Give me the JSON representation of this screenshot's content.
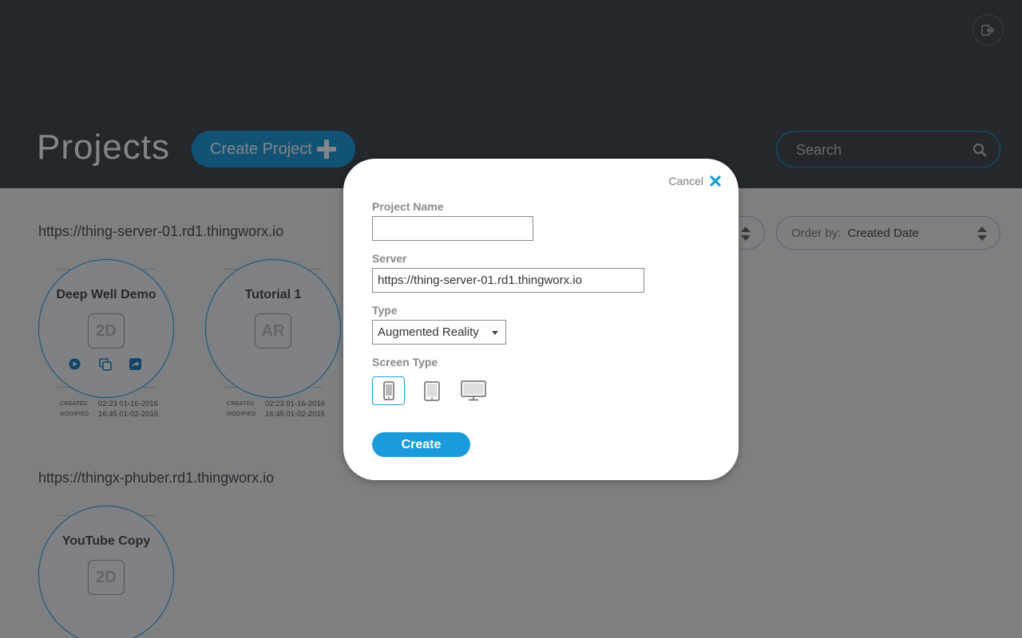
{
  "header": {
    "title": "Projects",
    "create_project_label": "Create Project",
    "search_placeholder": "Search"
  },
  "toolbar": {
    "order_by_label": "Order by:",
    "order_by_value": "Created Date"
  },
  "groups": [
    {
      "server": "https://thing-server-01.rd1.thingworx.io",
      "projects": [
        {
          "name": "Deep Well Demo",
          "type": "2D",
          "created_label": "CREATED",
          "created": "02:23 01-16-2016",
          "modified_label": "MODIFIED",
          "modified": "16:45 01-02-2016"
        },
        {
          "name": "Tutorial 1",
          "type": "AR",
          "created_label": "CREATED",
          "created": "02:23 01-16-2016",
          "modified_label": "MODIFIED",
          "modified": "16:45 01-02-2016"
        }
      ]
    },
    {
      "server": "https://thingx-phuber.rd1.thingworx.io",
      "projects": [
        {
          "name": "YouTube Copy",
          "type": "2D"
        }
      ]
    }
  ],
  "modal": {
    "cancel_label": "Cancel",
    "project_name_label": "Project Name",
    "project_name_value": "",
    "server_label": "Server",
    "server_value": "https://thing-server-01.rd1.thingworx.io",
    "type_label": "Type",
    "type_value": "Augmented Reality",
    "screen_type_label": "Screen Type",
    "screen_types": [
      "phone-icon",
      "tablet-icon",
      "desktop-icon"
    ],
    "selected_screen_type": "phone-icon",
    "create_label": "Create"
  },
  "colors": {
    "accent": "#1b9bdb",
    "header_bg": "#3e4249"
  }
}
